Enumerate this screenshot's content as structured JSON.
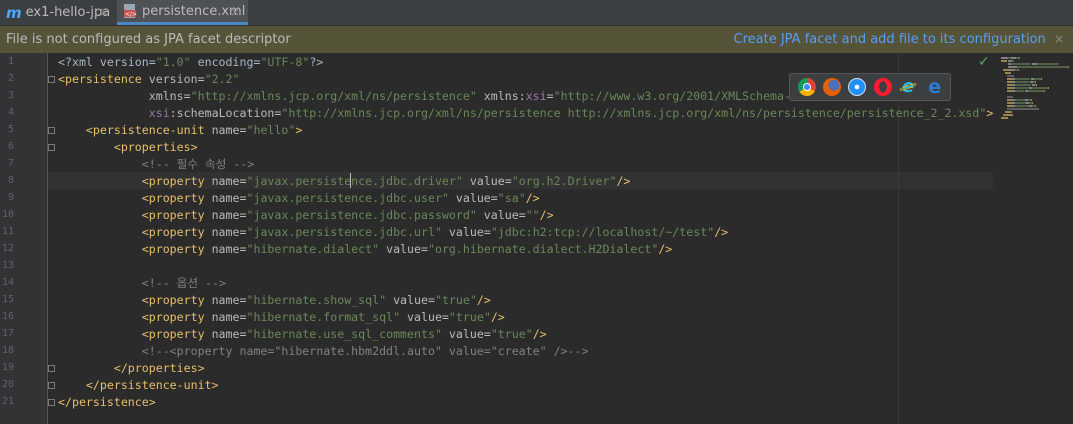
{
  "tabs": [
    {
      "icon": "m",
      "label": "ex1-hello-jpa",
      "close": "×"
    },
    {
      "icon": "xml-file-icon",
      "label": "persistence.xml",
      "close": "×"
    }
  ],
  "banner": {
    "message": "File is not configured as JPA facet descriptor",
    "link": "Create JPA facet and add file to its configuration",
    "close": "×"
  },
  "editor": {
    "status": "✓",
    "line_numbers": [
      "1",
      "2",
      "3",
      "4",
      "5",
      "6",
      "7",
      "8",
      "9",
      "10",
      "11",
      "12",
      "13",
      "14",
      "15",
      "16",
      "17",
      "18",
      "19",
      "20",
      "21"
    ],
    "lines": [
      [
        {
          "t": "<?xml version=",
          "c": "plain"
        },
        {
          "t": "\"1.0\"",
          "c": "val"
        },
        {
          "t": " encoding=",
          "c": "plain"
        },
        {
          "t": "\"UTF-8\"",
          "c": "val"
        },
        {
          "t": "?>",
          "c": "plain"
        }
      ],
      [
        {
          "t": "<persistence",
          "c": "tag"
        },
        {
          "t": " version=",
          "c": "attr"
        },
        {
          "t": "\"2.2\"",
          "c": "val"
        }
      ],
      [
        {
          "t": "             xmlns=",
          "c": "attr"
        },
        {
          "t": "\"http://xmlns.jcp.org/xml/ns/persistence\"",
          "c": "val"
        },
        {
          "t": " xmlns:",
          "c": "attr"
        },
        {
          "t": "xsi",
          "c": "ns"
        },
        {
          "t": "=",
          "c": "attr"
        },
        {
          "t": "\"http://www.w3.org/2001/XMLSchema-instance\"",
          "c": "val"
        }
      ],
      [
        {
          "t": "             ",
          "c": "plain"
        },
        {
          "t": "xsi",
          "c": "ns"
        },
        {
          "t": ":schemaLocation=",
          "c": "attr"
        },
        {
          "t": "\"http://xmlns.jcp.org/xml/ns/persistence http://xmlns.jcp.org/xml/ns/persistence/persistence_2_2.xsd\"",
          "c": "val"
        },
        {
          "t": ">",
          "c": "tag"
        }
      ],
      [
        {
          "t": "    <persistence-unit",
          "c": "tag"
        },
        {
          "t": " name=",
          "c": "attr"
        },
        {
          "t": "\"hello\"",
          "c": "val"
        },
        {
          "t": ">",
          "c": "tag"
        }
      ],
      [
        {
          "t": "        <properties>",
          "c": "tag"
        }
      ],
      [
        {
          "t": "            <!-- 필수 속성 -->",
          "c": "cmt"
        }
      ],
      [
        {
          "t": "            <property",
          "c": "tag"
        },
        {
          "t": " name=",
          "c": "attr"
        },
        {
          "t": "\"javax.persistence.jdbc.driver\"",
          "c": "val"
        },
        {
          "t": " value=",
          "c": "attr"
        },
        {
          "t": "\"org.h2.Driver\"",
          "c": "val"
        },
        {
          "t": "/>",
          "c": "tag"
        }
      ],
      [
        {
          "t": "            <property",
          "c": "tag"
        },
        {
          "t": " name=",
          "c": "attr"
        },
        {
          "t": "\"javax.persistence.jdbc.user\"",
          "c": "val"
        },
        {
          "t": " value=",
          "c": "attr"
        },
        {
          "t": "\"sa\"",
          "c": "val"
        },
        {
          "t": "/>",
          "c": "tag"
        }
      ],
      [
        {
          "t": "            <property",
          "c": "tag"
        },
        {
          "t": " name=",
          "c": "attr"
        },
        {
          "t": "\"javax.persistence.jdbc.password\"",
          "c": "val"
        },
        {
          "t": " value=",
          "c": "attr"
        },
        {
          "t": "\"\"",
          "c": "val"
        },
        {
          "t": "/>",
          "c": "tag"
        }
      ],
      [
        {
          "t": "            <property",
          "c": "tag"
        },
        {
          "t": " name=",
          "c": "attr"
        },
        {
          "t": "\"javax.persistence.jdbc.url\"",
          "c": "val"
        },
        {
          "t": " value=",
          "c": "attr"
        },
        {
          "t": "\"jdbc:h2:tcp://localhost/~/test\"",
          "c": "val"
        },
        {
          "t": "/>",
          "c": "tag"
        }
      ],
      [
        {
          "t": "            <property",
          "c": "tag"
        },
        {
          "t": " name=",
          "c": "attr"
        },
        {
          "t": "\"hibernate.dialect\"",
          "c": "val"
        },
        {
          "t": " value=",
          "c": "attr"
        },
        {
          "t": "\"org.hibernate.dialect.H2Dialect\"",
          "c": "val"
        },
        {
          "t": "/>",
          "c": "tag"
        }
      ],
      [],
      [
        {
          "t": "            <!-- 옵션 -->",
          "c": "cmt"
        }
      ],
      [
        {
          "t": "            <property",
          "c": "tag"
        },
        {
          "t": " name=",
          "c": "attr"
        },
        {
          "t": "\"hibernate.show_sql\"",
          "c": "val"
        },
        {
          "t": " value=",
          "c": "attr"
        },
        {
          "t": "\"true\"",
          "c": "val"
        },
        {
          "t": "/>",
          "c": "tag"
        }
      ],
      [
        {
          "t": "            <property",
          "c": "tag"
        },
        {
          "t": " name=",
          "c": "attr"
        },
        {
          "t": "\"hibernate.format_sql\"",
          "c": "val"
        },
        {
          "t": " value=",
          "c": "attr"
        },
        {
          "t": "\"true\"",
          "c": "val"
        },
        {
          "t": "/>",
          "c": "tag"
        }
      ],
      [
        {
          "t": "            <property",
          "c": "tag"
        },
        {
          "t": " name=",
          "c": "attr"
        },
        {
          "t": "\"hibernate.use_sql_comments\"",
          "c": "val"
        },
        {
          "t": " value=",
          "c": "attr"
        },
        {
          "t": "\"true\"",
          "c": "val"
        },
        {
          "t": "/>",
          "c": "tag"
        }
      ],
      [
        {
          "t": "            <!--<property name=\"hibernate.hbm2ddl.auto\" value=\"create\" />-->",
          "c": "cmt"
        }
      ],
      [
        {
          "t": "        </properties>",
          "c": "tag"
        }
      ],
      [
        {
          "t": "    </persistence-unit>",
          "c": "tag"
        }
      ],
      [
        {
          "t": "</persistence>",
          "c": "tag"
        }
      ]
    ]
  },
  "browsers": [
    "chrome-icon",
    "firefox-icon",
    "safari-icon",
    "opera-icon",
    "ie-icon",
    "edge-icon"
  ],
  "colors": {
    "tag": "#e8bf6a",
    "attr": "#bababa",
    "value": "#6a8759",
    "comment": "#808080",
    "namespace": "#9876aa",
    "link": "#589df6",
    "banner": "#555338"
  }
}
